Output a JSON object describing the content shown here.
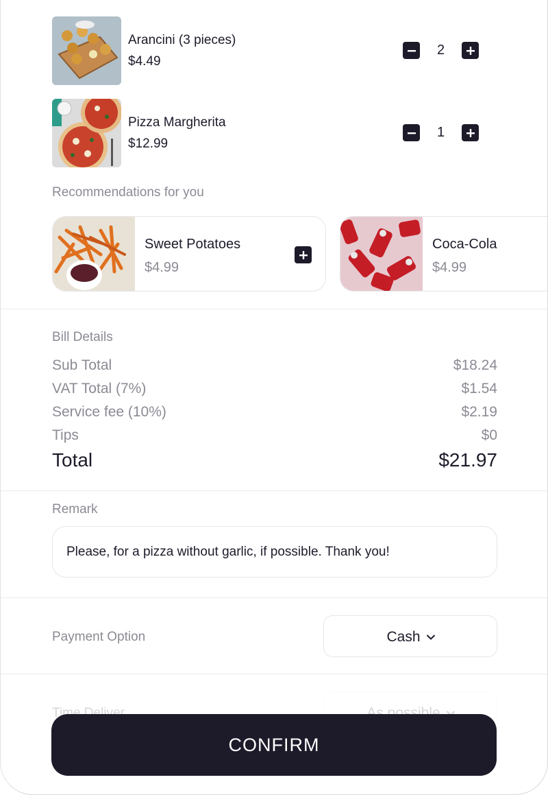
{
  "cart": {
    "items": [
      {
        "name": "Arancini (3 pieces)",
        "price": "$4.49",
        "quantity": "2"
      },
      {
        "name": "Pizza Margherita",
        "price": "$12.99",
        "quantity": "1"
      }
    ]
  },
  "recommendations": {
    "title": "Recommendations for you",
    "items": [
      {
        "name": "Sweet Potatoes",
        "price": "$4.99"
      },
      {
        "name": "Coca-Cola",
        "price": "$4.99"
      }
    ]
  },
  "bill": {
    "title": "Bill Details",
    "rows": [
      {
        "label": "Sub Total",
        "value": "$18.24"
      },
      {
        "label": "VAT Total (7%)",
        "value": "$1.54"
      },
      {
        "label": "Service fee (10%)",
        "value": "$2.19"
      },
      {
        "label": "Tips",
        "value": "$0"
      }
    ],
    "total_label": "Total",
    "total_value": "$21.97"
  },
  "remark": {
    "title": "Remark",
    "text": "Please, for a pizza without garlic, if possible. Thank you!"
  },
  "payment": {
    "label": "Payment Option",
    "selected": "Cash"
  },
  "delivery": {
    "label": "Time Deliver",
    "selected": "As possible"
  },
  "confirm_label": "CONFIRM",
  "icons": {
    "minus": "minus-icon",
    "plus": "plus-icon",
    "chevron": "chevron-down-icon"
  },
  "colors": {
    "primary": "#1d1b2a",
    "muted_text": "#8c8a94",
    "border": "#e6e6ea",
    "background": "#ffffff"
  }
}
